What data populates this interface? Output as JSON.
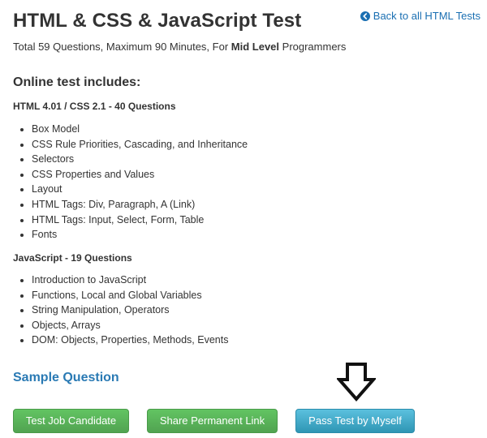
{
  "header": {
    "title": "HTML & CSS & JavaScript Test",
    "back_link": "Back to all HTML Tests",
    "subtitle_prefix": "Total 59 Questions, Maximum 90 Minutes, For ",
    "subtitle_level": "Mid Level",
    "subtitle_suffix": " Programmers"
  },
  "includes": {
    "heading": "Online test includes:",
    "groups": [
      {
        "heading": "HTML 4.01 / CSS 2.1  -  40 Questions",
        "topics": [
          "Box Model",
          "CSS Rule Priorities, Cascading, and Inheritance",
          "Selectors",
          "CSS Properties and Values",
          "Layout",
          "HTML Tags: Div, Paragraph, A (Link)",
          "HTML Tags: Input, Select, Form, Table",
          "Fonts"
        ]
      },
      {
        "heading": "JavaScript  -  19 Questions",
        "topics": [
          "Introduction to JavaScript",
          "Functions, Local and Global Variables",
          "String Manipulation, Operators",
          "Objects, Arrays",
          "DOM: Objects, Properties, Methods, Events"
        ]
      }
    ]
  },
  "sample": {
    "label": "Sample Question"
  },
  "actions": {
    "test_candidate": "Test Job Candidate",
    "share_link": "Share Permanent Link",
    "pass_myself": "Pass Test by Myself"
  },
  "icons": {
    "back": "circle-arrow-left-icon",
    "pointer": "down-arrow-icon"
  },
  "colors": {
    "link": "#1a6fb2",
    "heading_link": "#2a7ab4",
    "green_button": "#5cb85c",
    "blue_button": "#3fa9cf",
    "text": "#333333"
  }
}
